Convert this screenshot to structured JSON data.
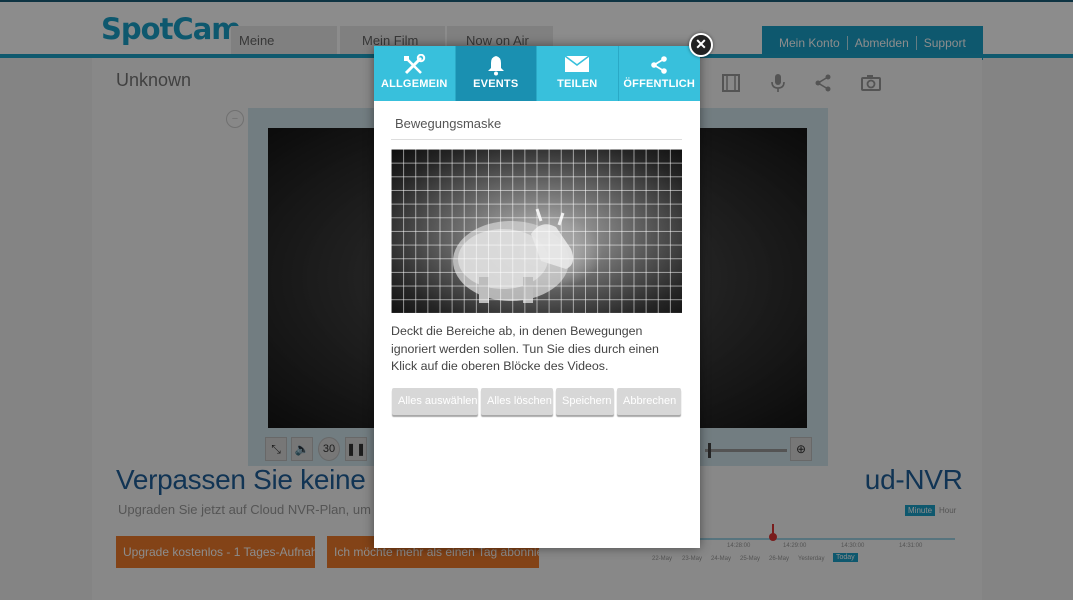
{
  "header": {
    "logo": "SpotCam",
    "nav_tabs": [
      "Meine SpotCam",
      "Mein Film",
      "Now on Air"
    ],
    "account_links": [
      "Mein Konto",
      "Abmelden",
      "Support"
    ]
  },
  "camera": {
    "title": "Unknown",
    "toolbar_icons": [
      "film-icon",
      "microphone-icon",
      "share-icon",
      "camera-icon"
    ],
    "controls": {
      "rewind_label": "30",
      "fullscreen_icon": "⤡",
      "volume_icon": "🔈",
      "pause_icon": "❚❚",
      "zoom_icon": "⊕"
    }
  },
  "promo": {
    "headline": "Verpassen Sie keine Gele                                                          ud-NVR",
    "subtext": "Upgraden Sie jetzt auf Cloud NVR-Plan, um Ih                                            ein ruhiges Gewissen.",
    "upgrade_button": "Upgrade kostenlos - 1 Tages-Aufnahme",
    "secondary_button": "Ich möchte mehr als einen Tag abonnieren"
  },
  "timeline": {
    "toggle_minute": "Minute",
    "toggle_hour": "Hour",
    "times": [
      "14:28:00",
      "14:29:00",
      "14:30:00",
      "14:31:00"
    ],
    "days": [
      "22-May",
      "23-May",
      "24-May",
      "25-May",
      "26-May",
      "Yesterday"
    ],
    "today_label": "Today"
  },
  "modal": {
    "tabs": [
      {
        "label": "ALLGEMEIN",
        "icon": "tools-icon",
        "active": false
      },
      {
        "label": "EVENTS",
        "icon": "bell-icon",
        "active": true
      },
      {
        "label": "TEILEN",
        "icon": "envelope-icon",
        "active": false
      },
      {
        "label": "ÖFFENTLICH",
        "icon": "share-icon",
        "active": false
      }
    ],
    "close_glyph": "✕",
    "section_title": "Bewegungsmaske",
    "instructions": "Deckt die Bereiche ab, in denen Bewegungen ignoriert werden sollen. Tun Sie dies durch einen Klick auf die oberen Blöcke des Videos.",
    "buttons": {
      "select_all": "Alles auswählen",
      "clear_all": "Alles löschen",
      "save": "Speichern",
      "cancel": "Abbrechen"
    }
  },
  "colors": {
    "brand": "#1aa0c8",
    "tab_active": "#1a90b1",
    "tab_inactive": "#38c0dc",
    "promo_orange": "#ef7a2a",
    "headline_blue": "#1f5f9a"
  }
}
